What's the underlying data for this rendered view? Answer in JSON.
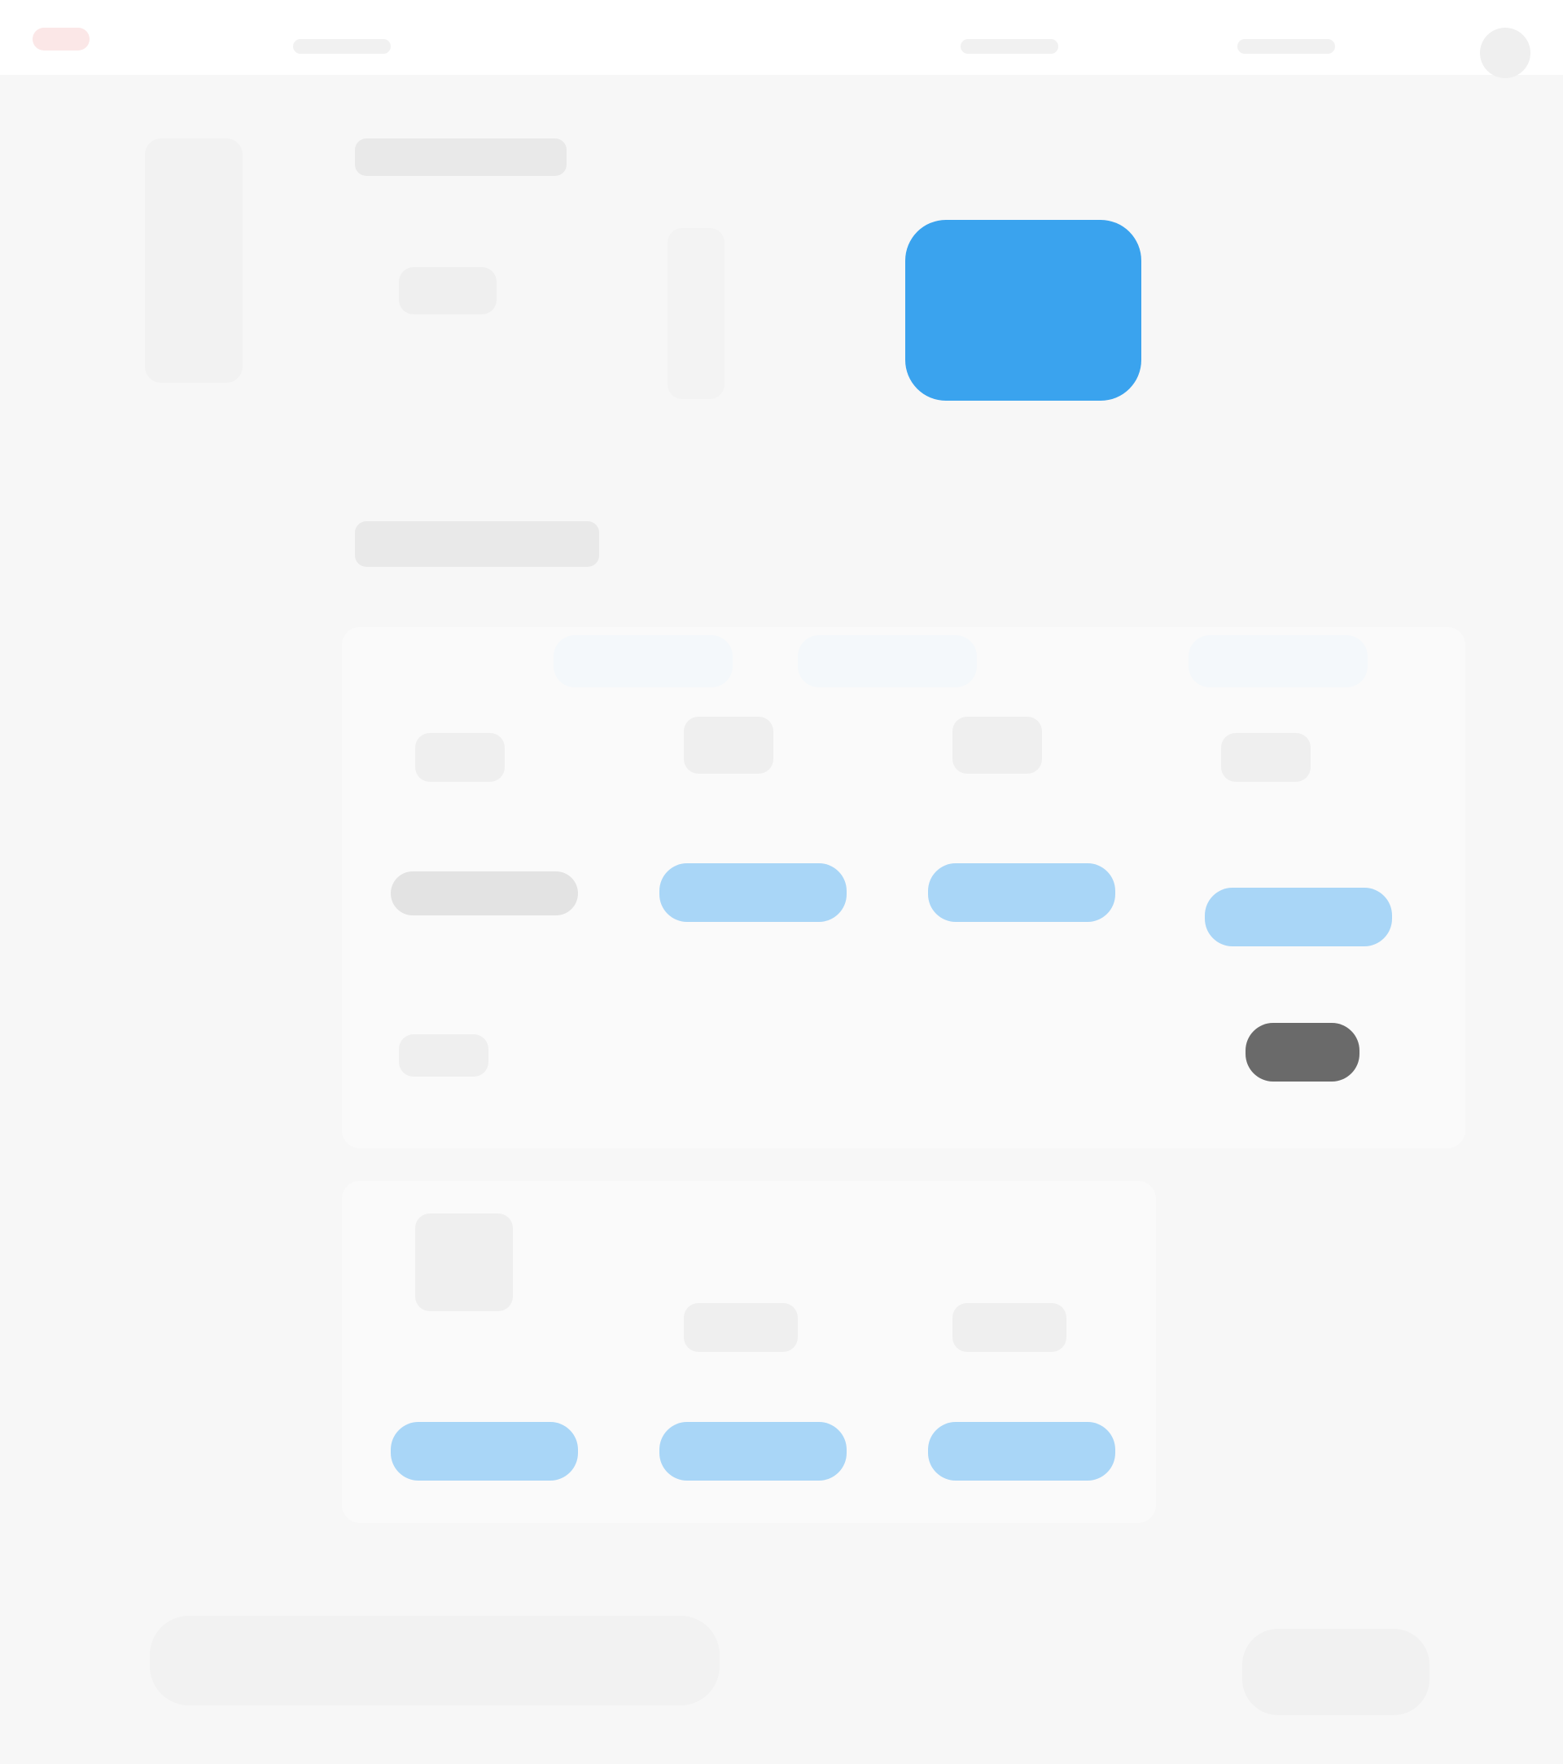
{
  "colors": {
    "background": "#f7f7f7",
    "topbar": "#ffffff",
    "accent_blue": "#3aa3ee",
    "pill_blue": "#a9d6f7",
    "pill_grey": "#e3e3e3",
    "pill_dark": "#6a6a6a",
    "accent_red": "#fbe7e7"
  }
}
